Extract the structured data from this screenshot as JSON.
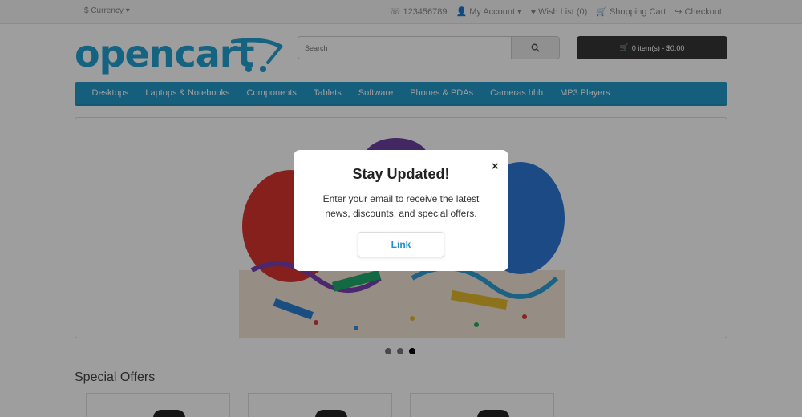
{
  "topbar": {
    "currency": "$ Currency",
    "phone": "123456789",
    "my_account": "My Account",
    "wish_list": "Wish List (0)",
    "shopping_cart": "Shopping Cart",
    "checkout": "Checkout"
  },
  "header": {
    "logo_text": "opencart",
    "search_placeholder": "Search",
    "cart_button": "0 item(s) - $0.00"
  },
  "nav": {
    "items": [
      "Desktops",
      "Laptops & Notebooks",
      "Components",
      "Tablets",
      "Software",
      "Phones & PDAs",
      "Cameras hhh",
      "MP3 Players"
    ]
  },
  "section": {
    "special_offers": "Special Offers"
  },
  "modal": {
    "title": "Stay Updated!",
    "body": "Enter your email to receive the latest news, discounts, and special offers.",
    "close": "×",
    "button": "Link"
  },
  "colors": {
    "brand": "#23a1d1",
    "nav_bg": "#229ac8",
    "cart_bg": "#363636",
    "link": "#1f8fcf"
  }
}
